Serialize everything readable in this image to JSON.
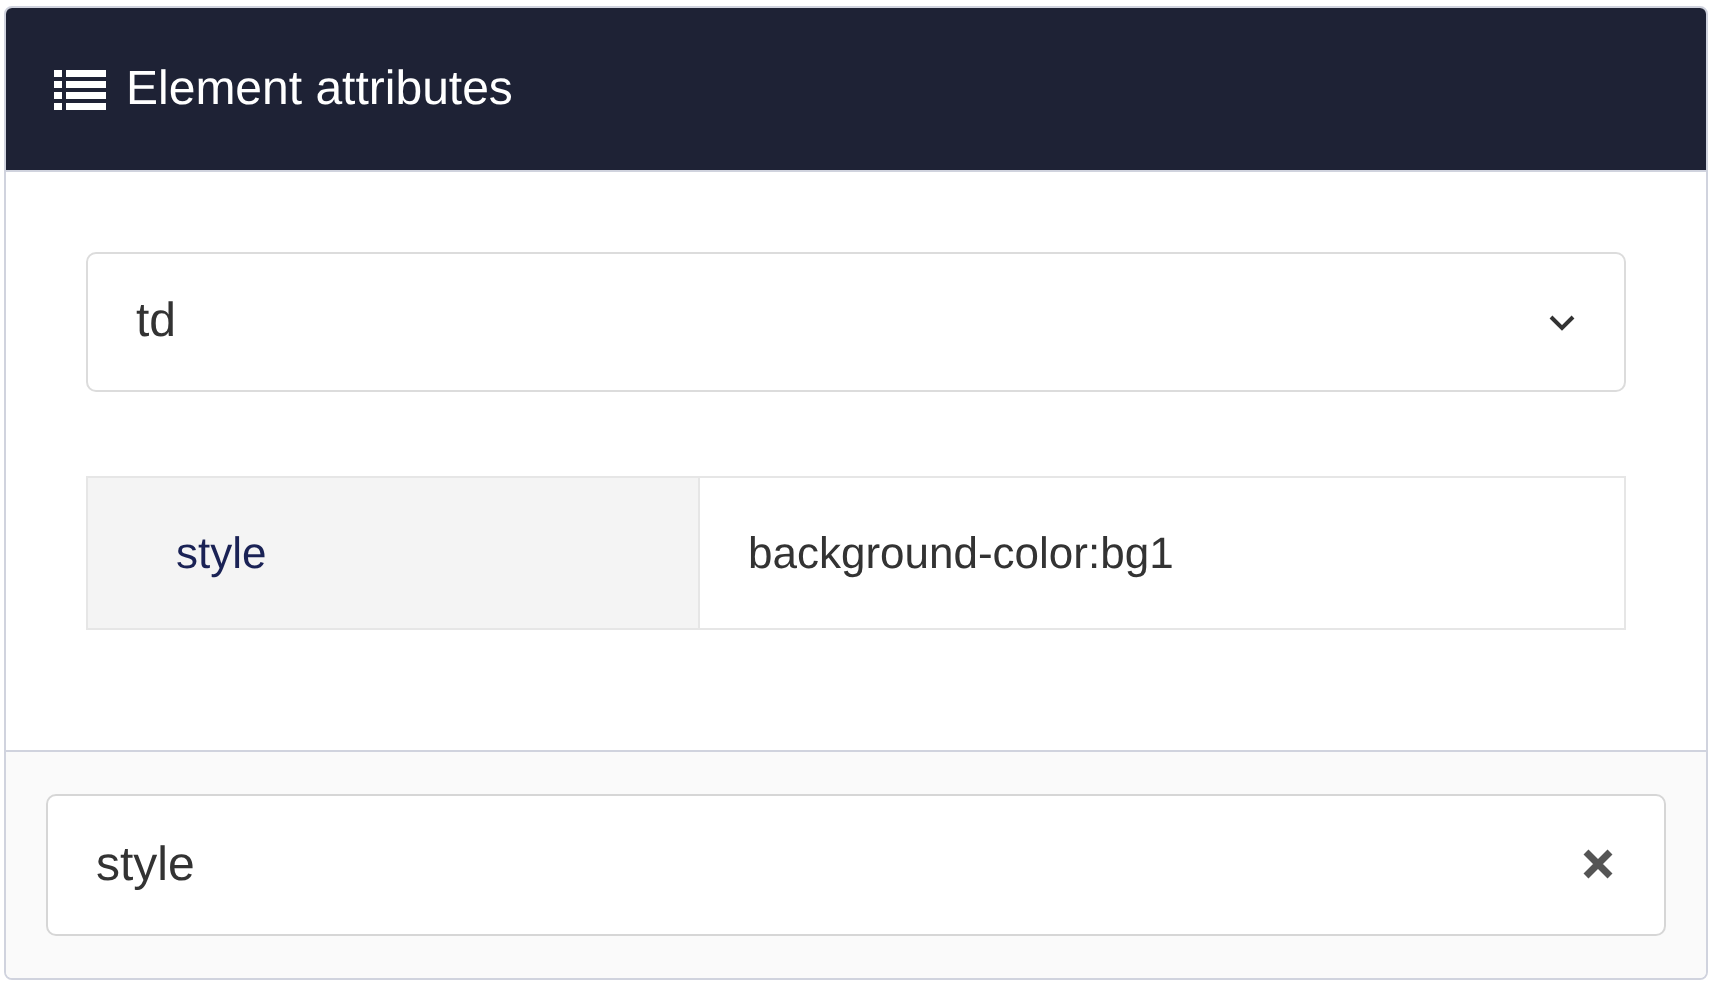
{
  "panel": {
    "title": "Element attributes"
  },
  "element_select": {
    "value": "td"
  },
  "attributes": [
    {
      "name": "style",
      "value": "background-color:bg1"
    }
  ],
  "filter": {
    "value": "style"
  }
}
